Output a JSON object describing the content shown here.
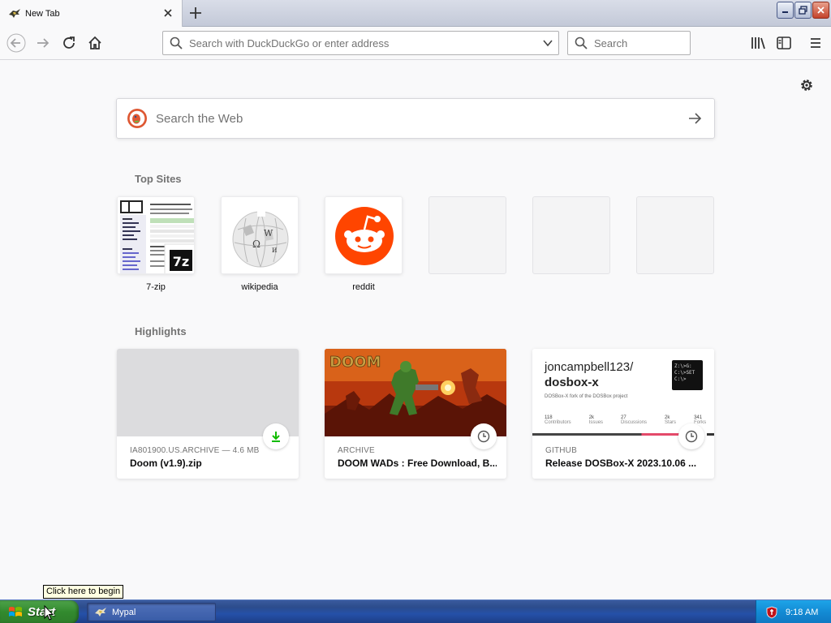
{
  "browser": {
    "tab": {
      "title": "New Tab",
      "favicon": "mypal-icon"
    },
    "urlbar": {
      "placeholder": "Search with DuckDuckGo or enter address"
    },
    "searchbar": {
      "placeholder": "Search"
    }
  },
  "newtab": {
    "web_search": {
      "placeholder": "Search the Web"
    },
    "top_sites": {
      "title": "Top Sites",
      "sites": [
        {
          "label": "7-zip"
        },
        {
          "label": "wikipedia"
        },
        {
          "label": "reddit"
        },
        {
          "label": ""
        },
        {
          "label": ""
        },
        {
          "label": ""
        }
      ]
    },
    "highlights": {
      "title": "Highlights",
      "cards": [
        {
          "context": "IA801900.US.ARCHIVE — 4.6 MB",
          "title": "Doom (v1.9).zip",
          "badge": "download-icon"
        },
        {
          "context": "ARCHIVE",
          "title": "DOOM WADs : Free Download, B...",
          "badge": "clock-icon"
        },
        {
          "context": "GITHUB",
          "title": "Release DOSBox-X 2023.10.06 ...",
          "badge": "clock-icon",
          "preview": {
            "owner": "joncampbell123/",
            "repo": "dosbox-x",
            "desc": "DOSBox-X fork of the DOSBox project",
            "stats": [
              {
                "n": "118",
                "l": "Contributors"
              },
              {
                "n": "2k",
                "l": "Issues"
              },
              {
                "n": "27",
                "l": "Discussions"
              },
              {
                "n": "2k",
                "l": "Stars"
              },
              {
                "n": "341",
                "l": "Forks"
              }
            ],
            "logo_lines": [
              "Z:\\>G:",
              "C:\\>SET",
              "C:\\>"
            ]
          }
        }
      ]
    }
  },
  "taskbar": {
    "start_label": "Start",
    "start_tooltip": "Click here to begin",
    "task_label": "Mypal",
    "clock": "9:18 AM"
  },
  "colors": {
    "reddit": "#ff4500",
    "start_green": "#328a2e",
    "taskbar_blue": "#2550a8",
    "tray_blue": "#138bd4"
  }
}
